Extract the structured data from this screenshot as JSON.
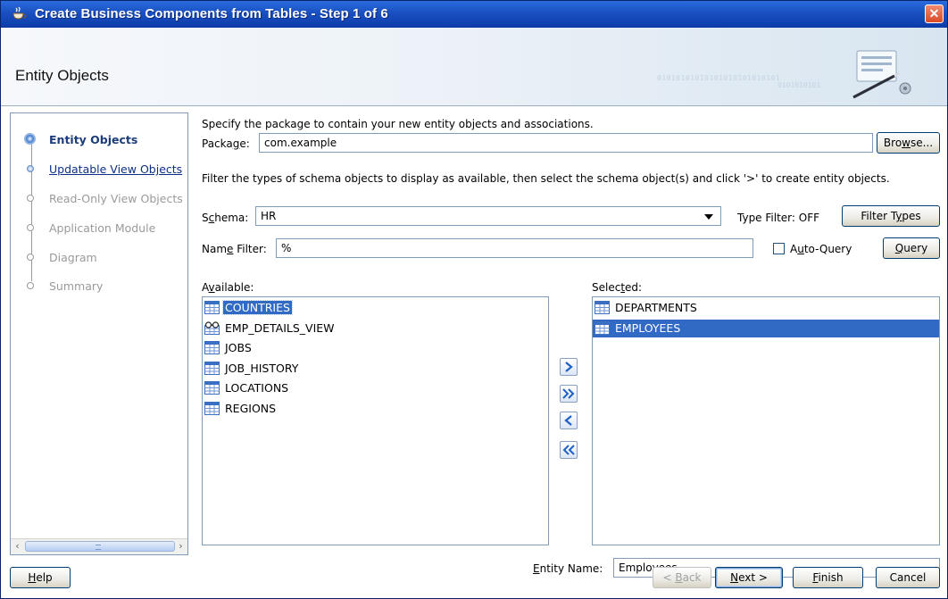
{
  "window": {
    "title": "Create Business Components from Tables - Step 1 of 6",
    "close_glyph": "✕"
  },
  "header": {
    "title": "Entity Objects",
    "decoration_binary": "01010101010101010101010101",
    "decoration_binary2": "0101010101"
  },
  "steps": [
    {
      "label": "Entity Objects",
      "state": "active"
    },
    {
      "label": "Updatable View Objects",
      "state": "link"
    },
    {
      "label": "Read-Only View Objects",
      "state": "disabled"
    },
    {
      "label": "Application Module",
      "state": "disabled"
    },
    {
      "label": "Diagram",
      "state": "disabled"
    },
    {
      "label": "Summary",
      "state": "disabled"
    }
  ],
  "scroll": {
    "left_arrow": "‹",
    "right_arrow": "›"
  },
  "form": {
    "package_intro": "Specify the package to contain your new entity objects and associations.",
    "package_label_pre": "Packa",
    "package_label_mn": "g",
    "package_label_post": "e:",
    "package_value": "com.example",
    "browse_pre": "Bro",
    "browse_mn": "w",
    "browse_post": "se...",
    "filter_instructions": "Filter the types of schema objects to display as available, then select the schema object(s) and click '>' to create entity objects.",
    "schema_label_pre": "S",
    "schema_label_mn": "c",
    "schema_label_post": "hema:",
    "schema_value": "HR",
    "type_filter_status": "Type Filter: OFF",
    "filter_types_pre": "Filter T",
    "filter_types_mn": "y",
    "filter_types_post": "pes",
    "name_filter_label_pre": "Nam",
    "name_filter_label_mn": "e",
    "name_filter_label_post": " Filter:",
    "name_filter_value": "%",
    "auto_query_pre": "A",
    "auto_query_mn": "u",
    "auto_query_post": "to-Query",
    "auto_query_checked": false,
    "query_pre": "",
    "query_mn": "Q",
    "query_post": "uery",
    "available_label_pre": "A",
    "available_label_mn": "v",
    "available_label_post": "ailable:",
    "selected_label_pre": "Selec",
    "selected_label_mn": "t",
    "selected_label_post": "ed:",
    "entity_name_label_pre": "",
    "entity_name_label_mn": "E",
    "entity_name_label_post": "ntity Name:",
    "entity_name_value": "Employees"
  },
  "available": [
    {
      "name": "COUNTRIES",
      "icon": "table-icon",
      "selected": true
    },
    {
      "name": "EMP_DETAILS_VIEW",
      "icon": "view-icon",
      "selected": false
    },
    {
      "name": "JOBS",
      "icon": "table-icon",
      "selected": false
    },
    {
      "name": "JOB_HISTORY",
      "icon": "table-icon",
      "selected": false
    },
    {
      "name": "LOCATIONS",
      "icon": "table-icon",
      "selected": false
    },
    {
      "name": "REGIONS",
      "icon": "table-icon",
      "selected": false
    }
  ],
  "selected": [
    {
      "name": "DEPARTMENTS",
      "icon": "table-icon",
      "selected": false
    },
    {
      "name": "EMPLOYEES",
      "icon": "table-icon",
      "selected": true
    }
  ],
  "shuttle_buttons": [
    "move-right",
    "move-all-right",
    "move-left",
    "move-all-left"
  ],
  "footer": {
    "help_pre": "",
    "help_mn": "H",
    "help_post": "elp",
    "back_pre": "< ",
    "back_mn": "B",
    "back_post": "ack",
    "next_pre": "",
    "next_mn": "N",
    "next_post": "ext >",
    "finish_pre": "",
    "finish_mn": "F",
    "finish_post": "inish",
    "cancel": "Cancel"
  },
  "colors": {
    "selection": "#316ac5",
    "titlebar": "#1a4fc1",
    "link": "#0e2f86"
  }
}
